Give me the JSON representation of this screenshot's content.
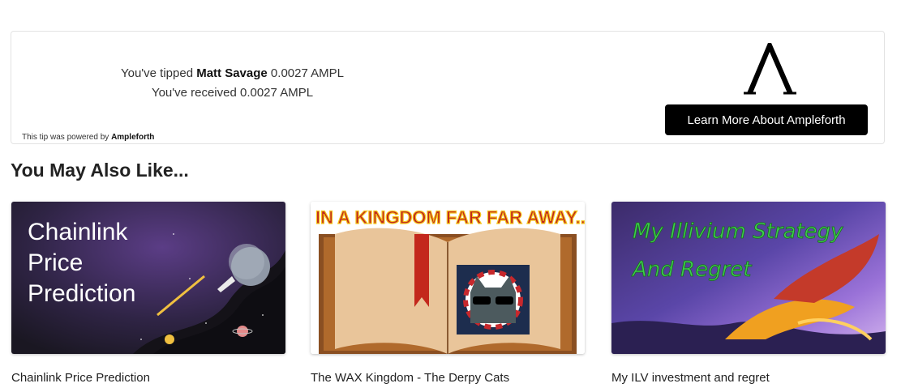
{
  "tip": {
    "prefix": "You've tipped ",
    "recipient": "Matt Savage",
    "tipped_amount": " 0.0027 AMPL",
    "received": "You've received 0.0027 AMPL",
    "powered_prefix": "This tip was powered by ",
    "powered_brand": "Ampleforth",
    "learn_button": "Learn More About Ampleforth"
  },
  "section_title": "You May Also Like...",
  "cards": [
    {
      "title": "Chainlink Price Prediction",
      "image_text": [
        "Chainlink",
        "Price",
        "Prediction"
      ]
    },
    {
      "title": "The WAX Kingdom - The Derpy Cats",
      "image_text": "IN A KINGDOM FAR FAR AWAY..."
    },
    {
      "title": "My ILV investment and regret",
      "image_text": [
        "My Illivium Strategy",
        "And Regret"
      ]
    }
  ],
  "colors": {
    "button_bg": "#000000",
    "button_text": "#ffffff",
    "border": "#e3e3e3"
  }
}
